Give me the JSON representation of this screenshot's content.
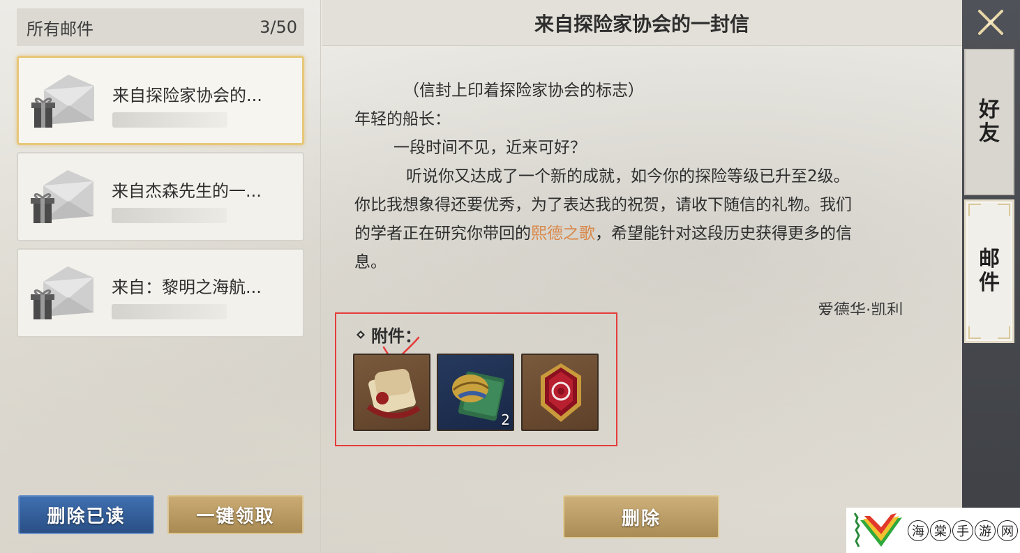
{
  "sidebar": {
    "header_label": "所有邮件",
    "count": "3/50",
    "mails": [
      {
        "title": "来自探险家协会的..."
      },
      {
        "title": "来自杰森先生的一..."
      },
      {
        "title": "来自：黎明之海航..."
      }
    ],
    "delete_read_label": "删除已读",
    "claim_all_label": "一键领取"
  },
  "letter": {
    "title": "来自探险家协会的一封信",
    "line_1": "（信封上印着探险家协会的标志）",
    "line_2": "年轻的船长：",
    "line_3": "一段时间不见，近来可好？",
    "line_4": "听说你又达成了一个新的成就，如今你的探险等级已升至2级。",
    "line_5": "你比我想象得还要优秀，为了表达我的祝贺，请收下随信的礼物。我们",
    "line_6_before": "的学者正在研究你带回的",
    "line_6_highlight": "熙德之歌",
    "line_6_after": "，希望能针对这段历史获得更多的信",
    "line_7": "息。",
    "signature": "爱德华·凯利",
    "attachments_label": "附件：",
    "attachment_count": "2",
    "delete_label": "删除"
  },
  "tabs": {
    "friends": [
      "好",
      "友"
    ],
    "mail": [
      "邮",
      "件"
    ]
  },
  "watermark": {
    "chars": [
      "海",
      "棠",
      "手",
      "游",
      "网"
    ]
  },
  "colors": {
    "highlight": "#d9884a",
    "selected_border": "#e7c77a",
    "annotation_red": "#e53c3c"
  }
}
